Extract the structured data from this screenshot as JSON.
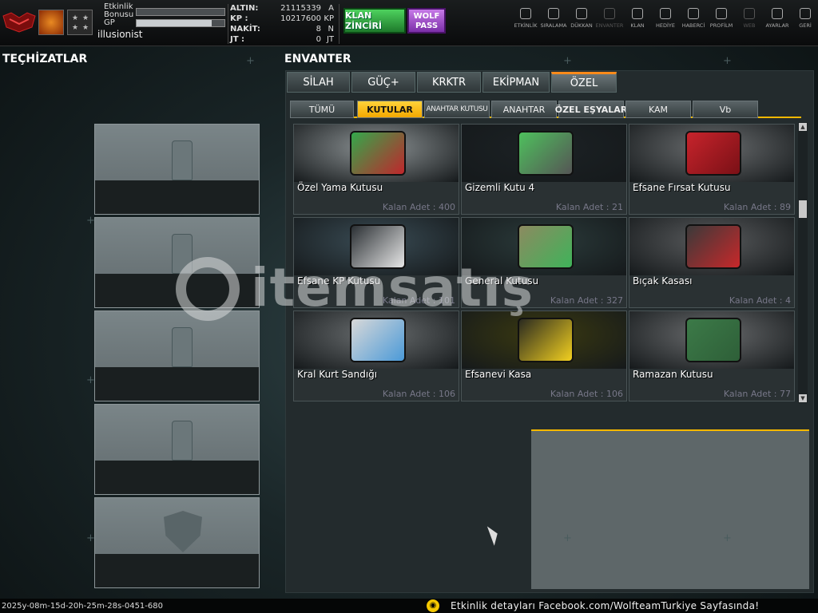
{
  "player": {
    "event_bonus_label": "Etkinlik Bonusu",
    "event_bonus_fill": 0.0,
    "gp_label": "GP",
    "gp_fill": 0.85,
    "username": "illusionist"
  },
  "currency": [
    {
      "label": "ALTIN:",
      "value": "21115339",
      "unit": "A"
    },
    {
      "label": "KP :",
      "value": "10217600",
      "unit": "KP"
    },
    {
      "label": "NAKİT:",
      "value": "8",
      "unit": "N"
    },
    {
      "label": "JT :",
      "value": "0",
      "unit": "JT"
    }
  ],
  "buttons": {
    "klan_chain": "KLAN ZİNCİRİ",
    "wolf_pass": "WOLF PASS"
  },
  "nav": [
    {
      "label": "ETKİNLİK",
      "icon": "clock-icon"
    },
    {
      "label": "SIRALAMA",
      "icon": "medal-icon"
    },
    {
      "label": "DÜKKAN",
      "icon": "cart-icon"
    },
    {
      "label": "ENVANTER",
      "icon": "inventory-icon",
      "dim": true
    },
    {
      "label": "KLAN",
      "icon": "clan-icon"
    },
    {
      "label": "HEDİYE",
      "icon": "gift-icon"
    },
    {
      "label": "HABERCİ",
      "icon": "megaphone-icon"
    },
    {
      "label": "PROFİLM",
      "icon": "profile-icon"
    },
    {
      "label": "WEB",
      "icon": "globe-icon",
      "dim": true
    },
    {
      "label": "AYARLAR",
      "icon": "gear-icon"
    },
    {
      "label": "GERİ",
      "icon": "back-icon"
    }
  ],
  "left_panel": {
    "title": "TEÇHİZATLAR"
  },
  "inventory": {
    "title": "ENVANTER",
    "tabs": [
      "SİLAH",
      "GÜÇ+",
      "KRKTR",
      "EKİPMAN",
      "ÖZEL"
    ],
    "active_tab": "ÖZEL",
    "subtabs": [
      "TÜMÜ",
      "KUTULAR",
      "ANAHTAR KUTUSU",
      "ANAHTAR",
      "ÖZEL EŞYALAR",
      "KAM",
      "Vb"
    ],
    "active_subtab": "KUTULAR",
    "items": [
      {
        "name": "Özel Yama Kutusu",
        "count": "Kalan Adet : 400"
      },
      {
        "name": "Gizemli Kutu 4",
        "count": "Kalan Adet : 21"
      },
      {
        "name": "Efsane Fırsat Kutusu",
        "count": "Kalan Adet : 89"
      },
      {
        "name": "Efsane KP Kutusu",
        "count": "Kalan Adet : 101"
      },
      {
        "name": "General Kutusu",
        "count": "Kalan Adet : 327"
      },
      {
        "name": "Bıçak Kasası",
        "count": "Kalan Adet : 4"
      },
      {
        "name": "Kral Kurt Sandığı",
        "count": "Kalan Adet : 106"
      },
      {
        "name": "Efsanevi Kasa",
        "count": "Kalan Adet : 106"
      },
      {
        "name": "Ramazan Kutusu",
        "count": "Kalan Adet : 77"
      }
    ]
  },
  "watermark": "itemsatış",
  "status": {
    "timestamp": "2025y-08m-15d-20h-25m-28s-0451-680",
    "event_message": "Etkinlik detayları Facebook.com/WolfteamTurkiye Sayfasında!"
  }
}
